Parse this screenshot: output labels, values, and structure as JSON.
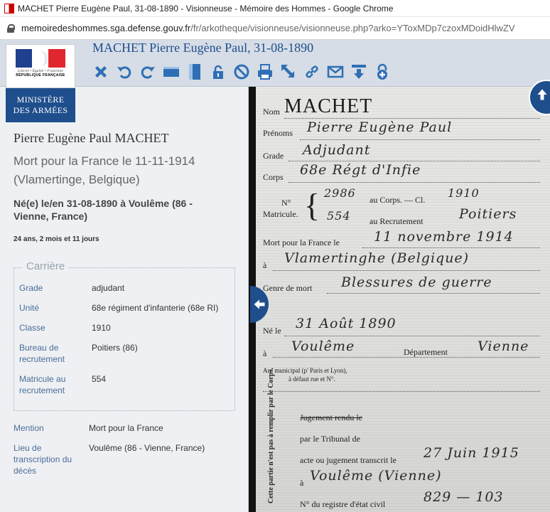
{
  "window": {
    "tab_title": "MACHET Pierre Eugène Paul, 31-08-1890 - Visionneuse - Mémoire des Hommes - Google Chrome",
    "url_host": "memoiredeshommes.sga.defense.gouv.fr",
    "url_path": "/fr/arkotheque/visionneuse/visionneuse.php?arko=YToxMDp7czoxMDoidHlwZV"
  },
  "logo": {
    "motto": "Liberté • Égalité • Fraternité",
    "republic": "RÉPUBLIQUE FRANÇAISE",
    "ministry_line1": "MINISTÈRE",
    "ministry_line2": "DES ARMÉES"
  },
  "viewer": {
    "title": "MACHET Pierre Eugène Paul, 31-08-1890",
    "toolbar": [
      {
        "icon": "close-icon"
      },
      {
        "icon": "rotate-left-icon"
      },
      {
        "icon": "rotate-right-icon"
      },
      {
        "icon": "fit-width-icon"
      },
      {
        "icon": "fit-height-icon"
      },
      {
        "icon": "lock-icon"
      },
      {
        "icon": "reset-icon"
      },
      {
        "icon": "print-icon"
      },
      {
        "icon": "fullscreen-icon"
      },
      {
        "icon": "link-icon"
      },
      {
        "icon": "email-icon"
      },
      {
        "icon": "download-icon"
      },
      {
        "icon": "add-basket-icon"
      }
    ]
  },
  "person": {
    "name": "Pierre Eugène Paul MACHET",
    "death": "Mort pour la France le 11-11-1914 (Vlamertinge, Belgique)",
    "birth": "Né(e) le/en 31-08-1890 à Voulême (86 - Vienne, France)",
    "age": "24 ans, 2 mois et 11 jours"
  },
  "career": {
    "legend": "Carrière",
    "rows": [
      {
        "label": "Grade",
        "value": "adjudant"
      },
      {
        "label": "Unité",
        "value": "68e régiment d'infanterie (68e RI)"
      },
      {
        "label": "Classe",
        "value": "1910"
      },
      {
        "label": "Bureau de recrutement",
        "value": "Poitiers (86)"
      },
      {
        "label": "Matricule au recrutement",
        "value": "554"
      }
    ]
  },
  "extra": [
    {
      "label": "Mention",
      "value": "Mort pour la France"
    },
    {
      "label": "Lieu de transcription du décès",
      "value": "Voulême (86 - Vienne, France)"
    }
  ],
  "document": {
    "nom_label": "Nom",
    "nom_value": "MACHET",
    "prenoms_label": "Prénoms",
    "prenoms_value": "Pierre Eugène Paul",
    "grade_label": "Grade",
    "grade_value": "Adjudant",
    "corps_label": "Corps",
    "corps_value": "68e Régt d'Infie",
    "no_label": "N°",
    "matricule_label": "Matricule.",
    "corps_no_value": "2986",
    "au_corps_label": "au Corps. — Cl.",
    "classe_value": "1910",
    "matricule_value": "554",
    "au_recrutement_label": "au Recrutement",
    "recrutement_value": "Poitiers",
    "mort_label": "Mort pour la France le",
    "mort_value": "11 novembre 1914",
    "a_label": "à",
    "lieu_mort_value": "Vlamertinghe (Belgique)",
    "genre_label": "Genre de mort",
    "genre_value": "Blessures de guerre",
    "ne_label": "Né le",
    "ne_value": "31 Août 1890",
    "lieu_ne_value": "Voulême",
    "departement_label": "Département",
    "departement_value": "Vienne",
    "arr_label": "Arr' municipal (p' Paris et Lyon),",
    "arr_label2": "à défaut rue et N°.",
    "side_note": "Cette partie n'est pas à remplir par le Corps.",
    "jugement_label": "Jugement rendu le",
    "tribunal_label": "par le Tribunal de",
    "acte_label": "acte ou jugement transcrit le",
    "acte_value": "27 Juin 1915",
    "lieu_acte_value": "Voulême (Vienne)",
    "registre_label": "N° du registre d'état civil",
    "registre_value": "829 — 103"
  }
}
